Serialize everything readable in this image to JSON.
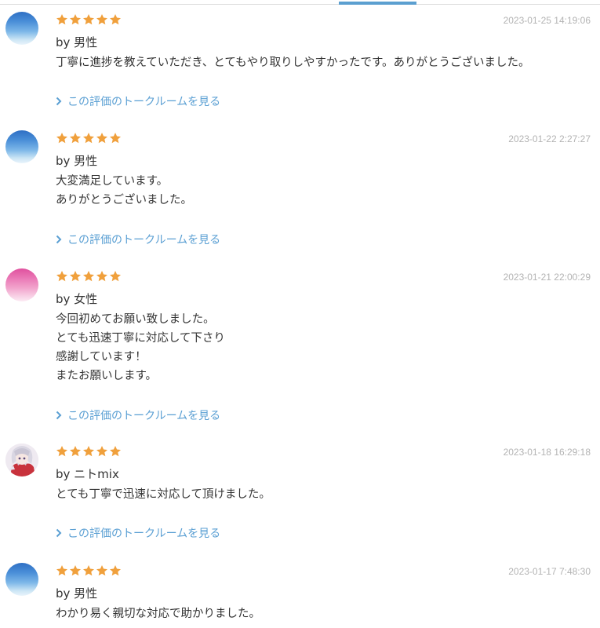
{
  "colors": {
    "star": "#f0a03c",
    "link": "#5a9fd3",
    "date": "#b3b3b3",
    "tab_indicator": "#5b9fd0"
  },
  "reviews": [
    {
      "date": "2023-01-25 14:19:06",
      "rating": 5,
      "author": "by 男性",
      "lines": [
        "丁寧に進捗を教えていただき、とてもやり取りしやすかったです。ありがとうございました。"
      ],
      "link": "この評価のトークルームを見る"
    },
    {
      "date": "2023-01-22 2:27:27",
      "rating": 5,
      "author": "by 男性",
      "lines": [
        "大変満足しています。",
        "ありがとうございました。"
      ],
      "link": "この評価のトークルームを見る"
    },
    {
      "date": "2023-01-21 22:00:29",
      "rating": 5,
      "author": "by 女性",
      "lines": [
        "今回初めてお願い致しました。",
        "とても迅速丁寧に対応して下さり",
        "感謝しています！",
        "またお願いします。"
      ],
      "link": "この評価のトークルームを見る"
    },
    {
      "date": "2023-01-18 16:29:18",
      "rating": 5,
      "author": "by ニトmix",
      "lines": [
        "とても丁寧で迅速に対応して頂けました。"
      ],
      "link": "この評価のトークルームを見る"
    },
    {
      "date": "2023-01-17 7:48:30",
      "rating": 5,
      "author": "by 男性",
      "lines": [
        "わかり易く親切な対応で助かりました。"
      ],
      "link": ""
    }
  ]
}
